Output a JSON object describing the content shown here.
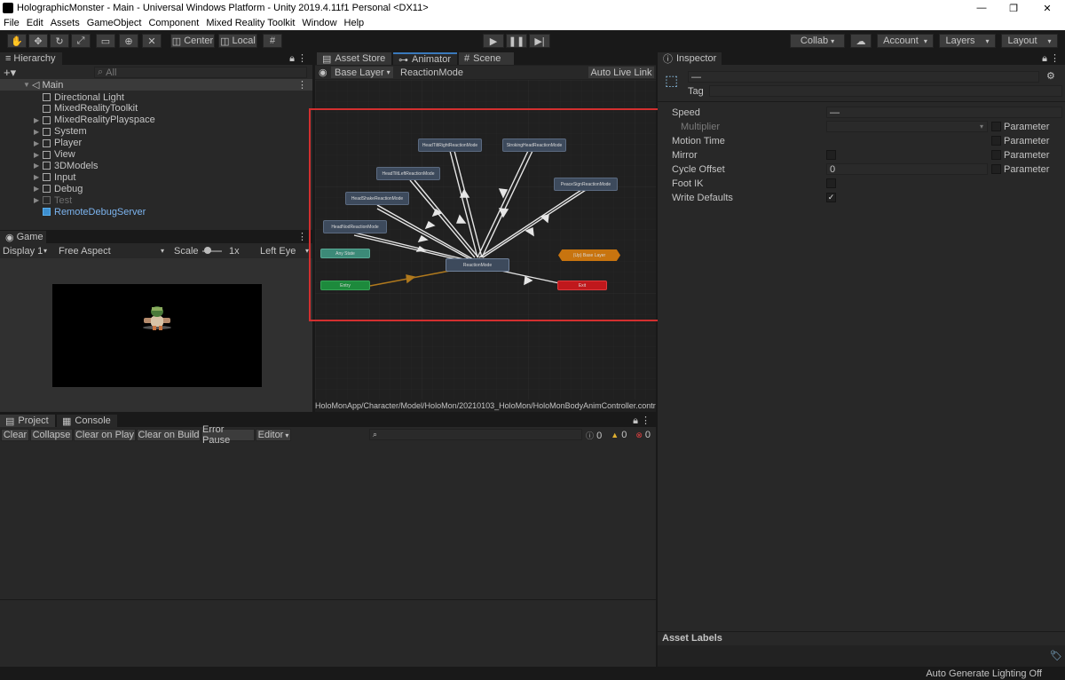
{
  "window": {
    "title": "HolographicMonster - Main - Universal Windows Platform - Unity 2019.4.11f1 Personal <DX11>"
  },
  "menu": [
    "File",
    "Edit",
    "Assets",
    "GameObject",
    "Component",
    "Mixed Reality Toolkit",
    "Window",
    "Help"
  ],
  "toolbar": {
    "center_label": "Center",
    "local_label": "Local",
    "collab_label": "Collab",
    "account_label": "Account",
    "layers_label": "Layers",
    "layout_label": "Layout"
  },
  "hierarchy": {
    "tab": "Hierarchy",
    "search_placeholder": "All",
    "scene": "Main",
    "items": [
      {
        "label": "Directional Light",
        "expandable": false
      },
      {
        "label": "MixedRealityToolkit",
        "expandable": false
      },
      {
        "label": "MixedRealityPlayspace",
        "expandable": true
      },
      {
        "label": "System",
        "expandable": true
      },
      {
        "label": "Player",
        "expandable": true
      },
      {
        "label": "View",
        "expandable": true
      },
      {
        "label": "3DModels",
        "expandable": true
      },
      {
        "label": "Input",
        "expandable": true
      },
      {
        "label": "Debug",
        "expandable": true
      },
      {
        "label": "Test",
        "expandable": true,
        "disabled": true
      },
      {
        "label": "RemoteDebugServer",
        "expandable": false,
        "prefab": true
      }
    ]
  },
  "game": {
    "tab": "Game",
    "display": "Display 1",
    "aspect": "Free Aspect",
    "scale_label": "Scale",
    "scale_value": "1x",
    "eye": "Left Eye"
  },
  "center": {
    "tabs": [
      "Asset Store",
      "Animator",
      "Scene"
    ],
    "breadcrumb": [
      "Base Layer",
      "ReactionMode"
    ],
    "live_link": "Auto Live Link",
    "path": "HoloMonApp/Character/Model/HoloMon/20210103_HoloMon/HoloMonBodyAnimController.controlle",
    "nodes": {
      "tiltright": "HeadTiltRightReactionMode",
      "stroking": "StrokingHeadReactionMode",
      "tiltleft": "HeadTiltLeftReactionMode",
      "peace": "PeaceSignReactionMode",
      "shake": "HeadShakeReactionMode",
      "nod": "HeadNodReactionMode",
      "anystate": "Any State",
      "reaction": "ReactionMode",
      "exitbase": "(Up) Base Layer",
      "entry": "Entry",
      "exit": "Exit"
    },
    "colors": {
      "highlight": "#d32f2f",
      "entry": "#1d8a3c",
      "exit": "#c0181c",
      "anystate": "#3c8a78",
      "upbase": "#c8740f",
      "node": "#3d4a5c"
    }
  },
  "console": {
    "tabs": [
      "Project",
      "Console"
    ],
    "buttons": [
      "Clear",
      "Collapse",
      "Clear on Play",
      "Clear on Build",
      "Error Pause",
      "Editor"
    ],
    "counts": [
      "0",
      "0",
      "0"
    ]
  },
  "inspector": {
    "tab": "Inspector",
    "name_value": "—",
    "tag_label": "Tag",
    "rows": [
      {
        "label": "Speed",
        "value": "—"
      },
      {
        "label": "Multiplier",
        "value": ""
      },
      {
        "label": "Motion Time",
        "value": ""
      },
      {
        "label": "Mirror",
        "value": ""
      },
      {
        "label": "Cycle Offset",
        "value": "0"
      },
      {
        "label": "Foot IK",
        "value": ""
      },
      {
        "label": "Write Defaults",
        "value": "✓"
      }
    ],
    "parameter_label": "Parameter",
    "asset_labels": "Asset Labels"
  },
  "status": {
    "text": "Auto Generate Lighting Off"
  }
}
